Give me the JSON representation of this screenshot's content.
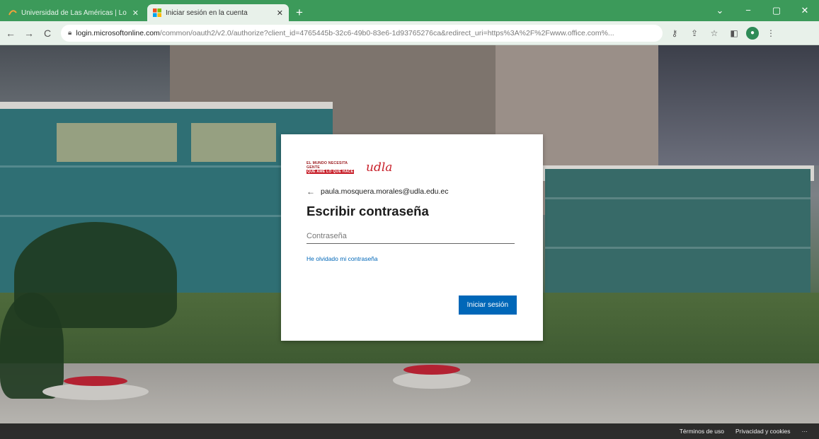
{
  "browser": {
    "tabs": [
      {
        "title": "Universidad de Las Américas | Lo",
        "active": false,
        "favicon": "udla-favicon"
      },
      {
        "title": "Iniciar sesión en la cuenta",
        "active": true,
        "favicon": "microsoft-favicon"
      }
    ],
    "new_tab": "+",
    "window_controls": {
      "minimize": "−",
      "restore": "▢",
      "close": "✕",
      "dropdown": "⌄"
    },
    "url_host": "login.microsoftonline.com",
    "url_path": "/common/oauth2/v2.0/authorize?client_id=4765445b-32c6-49b0-83e6-1d93765276ca&redirect_uri=https%3A%2F%2Fwww.office.com%...",
    "toolbar_icons": [
      "key-icon",
      "share-icon",
      "star-icon",
      "sidepanel-icon",
      "profile-icon",
      "menu-icon"
    ]
  },
  "login": {
    "logo_slogan_1": "EL MUNDO NECESITA GENTE",
    "logo_slogan_2": "QUE AME LO QUE HACE",
    "logo_mark": "udla",
    "identity": "paula.mosquera.morales@udla.edu.ec",
    "heading": "Escribir contraseña",
    "password_placeholder": "Contraseña",
    "password_value": "",
    "forgot_link": "He olvidado mi contraseña",
    "signin_button": "Iniciar sesión"
  },
  "footer": {
    "terms": "Términos de uso",
    "privacy": "Privacidad y cookies",
    "more": "···"
  },
  "colors": {
    "tabstrip": "#3c9a5a",
    "toolbar": "#e8f1ea",
    "accent": "#0067b8",
    "brand_red": "#c8202a"
  }
}
